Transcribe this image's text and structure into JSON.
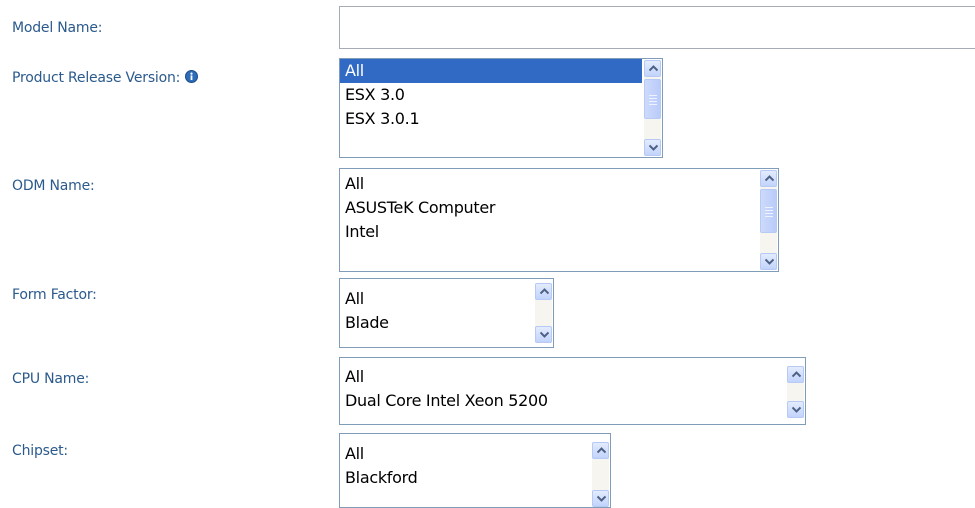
{
  "fields": {
    "model_name": {
      "label": "Model Name:",
      "value": ""
    },
    "product_release_version": {
      "label": "Product Release Version:",
      "icon": "info-icon",
      "options": [
        "All",
        "ESX 3.0",
        "ESX 3.0.1"
      ],
      "selected": "All"
    },
    "odm_name": {
      "label": "ODM Name:",
      "options": [
        "All",
        "ASUSTeK Computer",
        "Intel"
      ]
    },
    "form_factor": {
      "label": "Form Factor:",
      "options": [
        "All",
        "Blade"
      ]
    },
    "cpu_name": {
      "label": "CPU Name:",
      "options": [
        "All",
        "Dual Core Intel Xeon 5200"
      ]
    },
    "chipset": {
      "label": "Chipset:",
      "options": [
        "All",
        "Blackford"
      ]
    }
  },
  "colors": {
    "label_text": "#2b5a8c",
    "selection": "#316ac5",
    "listbox_border": "#7f9db9"
  }
}
